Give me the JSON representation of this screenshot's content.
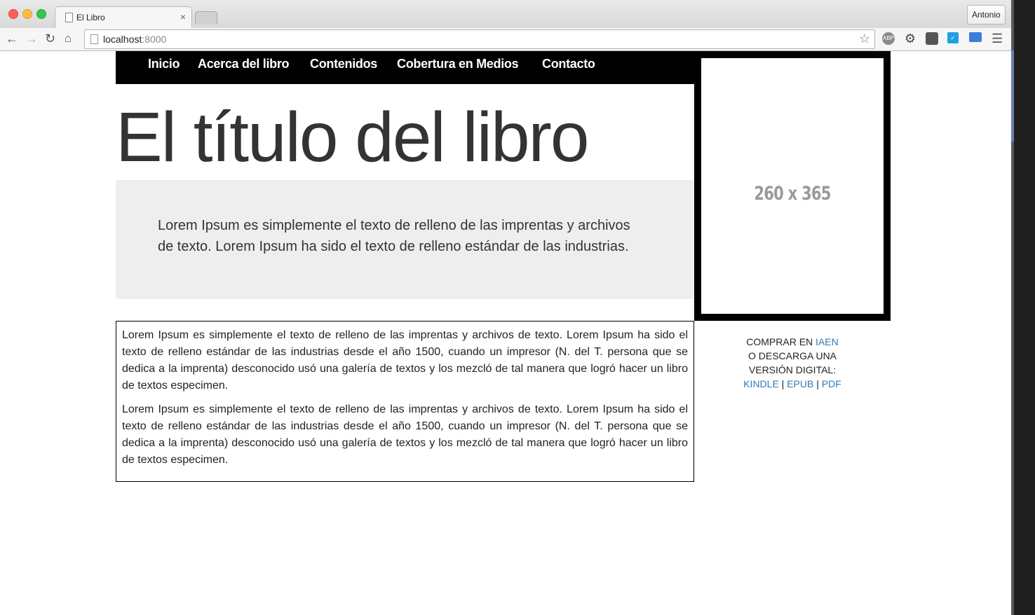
{
  "browser": {
    "tab_title": "El Libro",
    "tab_close": "×",
    "profile_label": "Antonio",
    "url_host": "localhost",
    "url_port": ":8000",
    "extensions": [
      "ABP",
      "settings",
      "pocket",
      "checkbox",
      "screen"
    ]
  },
  "nav": {
    "items": [
      {
        "label": "Inicio"
      },
      {
        "label": "Acerca del libro"
      },
      {
        "label": "Contenidos"
      },
      {
        "label": "Cobertura en Medios"
      },
      {
        "label": "Contacto"
      }
    ]
  },
  "cover": {
    "placeholder": "260 x 365"
  },
  "hero": {
    "title": "El título del libro",
    "lead": "Lorem Ipsum es simplemente el texto de relleno de las imprentas y archivos de texto. Lorem Ipsum ha sido el texto de relleno estándar de las industrias."
  },
  "content": {
    "paragraphs": [
      "Lorem Ipsum es simplemente el texto de relleno de las imprentas y archivos de texto. Lorem Ipsum ha sido el texto de relleno estándar de las industrias desde el año 1500, cuando un impresor (N. del T. persona que se dedica a la imprenta) desconocido usó una galería de textos y los mezcló de tal manera que logró hacer un libro de textos especimen.",
      "Lorem Ipsum es simplemente el texto de relleno de las imprentas y archivos de texto. Lorem Ipsum ha sido el texto de relleno estándar de las industrias desde el año 1500, cuando un impresor (N. del T. persona que se dedica a la imprenta) desconocido usó una galería de textos y los mezcló de tal manera que logró hacer un libro de textos especimen."
    ]
  },
  "buy": {
    "line1_prefix": "COMPRAR EN ",
    "line1_link": "IAEN",
    "line2": "O DESCARGA UNA",
    "line3": "VERSIÓN DIGITAL:",
    "kindle": "KINDLE",
    "epub": "EPUB",
    "pdf": "PDF",
    "sep": " | "
  },
  "colors": {
    "nav_bg": "#000000",
    "link": "#337ab7",
    "lead_bg": "#eeeeee"
  }
}
